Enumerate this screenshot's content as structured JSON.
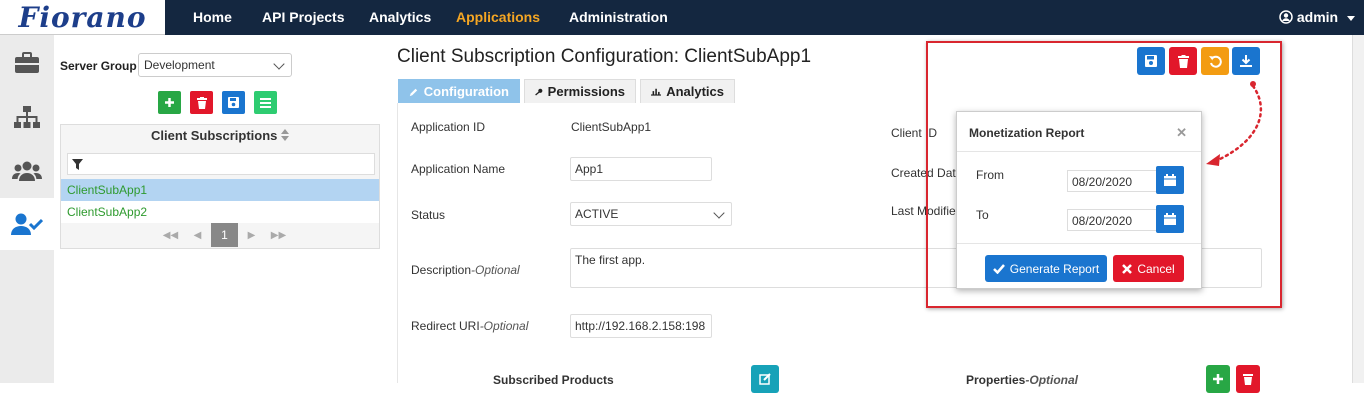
{
  "brand": {
    "logo": "Fiorano"
  },
  "topnav": {
    "items": [
      "Home",
      "API Projects",
      "Analytics",
      "Applications",
      "Administration"
    ],
    "active": "Applications",
    "user": "admin"
  },
  "leftpanel": {
    "server_group_label": "Server Group",
    "server_group_value": "Development",
    "list_title": "Client Subscriptions",
    "items": [
      "ClientSubApp1",
      "ClientSubApp2"
    ],
    "selected": "ClientSubApp1",
    "page": "1"
  },
  "page": {
    "title": "Client Subscription Configuration: ClientSubApp1",
    "tabs": [
      "Configuration",
      "Permissions",
      "Analytics"
    ],
    "active_tab": "Configuration"
  },
  "form": {
    "app_id_label": "Application ID",
    "app_id_value": "ClientSubApp1",
    "app_name_label": "Application Name",
    "app_name_value": "App1",
    "status_label": "Status",
    "status_value": "ACTIVE",
    "description_label": "Description",
    "description_optional": "-Optional",
    "description_value": "The first app.",
    "redirect_label": "Redirect URI",
    "redirect_optional": "-Optional",
    "redirect_value": "http://192.168.2.158:198",
    "client_id_label": "Client ID",
    "created_label": "Created Dat",
    "modified_label": "Last Modifie",
    "subscribed_products": "Subscribed Products",
    "properties_label": "Properties",
    "properties_optional": "-Optional"
  },
  "modal": {
    "title": "Monetization Report",
    "from_label": "From",
    "from_value": "08/20/2020",
    "to_label": "To",
    "to_value": "08/20/2020",
    "generate": "Generate Report",
    "cancel": "Cancel"
  },
  "colors": {
    "nav_bg": "#142740",
    "nav_active": "#f5a623",
    "primary": "#1a75cf",
    "danger": "#e2172a",
    "success": "#28a745",
    "warning": "#f39c12",
    "teal": "#17a2b8",
    "highlight_box": "#d9262f"
  }
}
